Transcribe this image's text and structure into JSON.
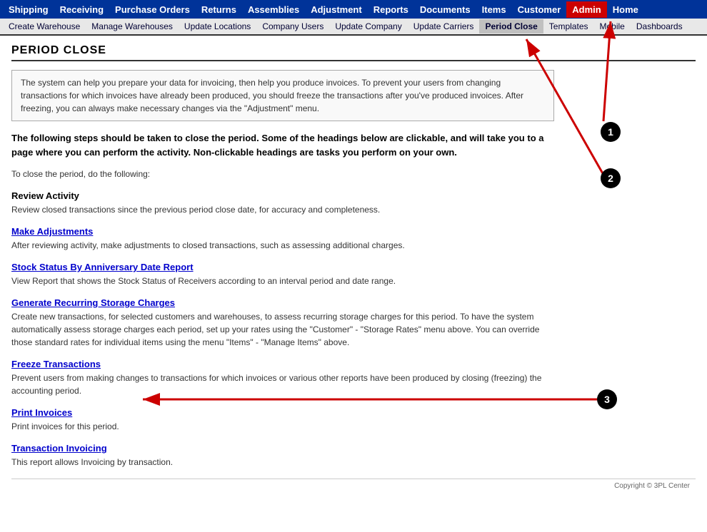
{
  "topNav": {
    "items": [
      {
        "label": "Shipping",
        "active": false
      },
      {
        "label": "Receiving",
        "active": false
      },
      {
        "label": "Purchase Orders",
        "active": false
      },
      {
        "label": "Returns",
        "active": false
      },
      {
        "label": "Assemblies",
        "active": false
      },
      {
        "label": "Adjustment",
        "active": false
      },
      {
        "label": "Reports",
        "active": false
      },
      {
        "label": "Documents",
        "active": false
      },
      {
        "label": "Items",
        "active": false
      },
      {
        "label": "Customer",
        "active": false
      },
      {
        "label": "Admin",
        "active": true
      },
      {
        "label": "Home",
        "active": false
      }
    ]
  },
  "subNav": {
    "items": [
      {
        "label": "Create Warehouse",
        "active": false
      },
      {
        "label": "Manage Warehouses",
        "active": false
      },
      {
        "label": "Update Locations",
        "active": false
      },
      {
        "label": "Company Users",
        "active": false
      },
      {
        "label": "Update Company",
        "active": false
      },
      {
        "label": "Update Carriers",
        "active": false
      },
      {
        "label": "Period Close",
        "active": true
      },
      {
        "label": "Templates",
        "active": false
      },
      {
        "label": "Mobile",
        "active": false
      },
      {
        "label": "Dashboards",
        "active": false
      }
    ]
  },
  "page": {
    "title": "Period Close",
    "infoBox": "The system can help you prepare your data for invoicing, then help you produce invoices. To prevent your users from changing transactions for which invoices have already been produced, you should freeze the transactions after you've produced invoices. After freezing, you can always make necessary changes via the \"Adjustment\" menu.",
    "boldIntro": "The following steps should be taken to close the period. Some of the headings below are clickable, and will take you to a page where you can perform the activity. Non-clickable headings are tasks you perform on your own.",
    "introText": "To close the period, do the following:",
    "sections": [
      {
        "title": "Review Activity",
        "isLink": false,
        "desc": "Review closed transactions since the previous period close date, for accuracy and completeness."
      },
      {
        "title": "Make Adjustments",
        "isLink": true,
        "desc": "After reviewing activity, make adjustments to closed transactions, such as assessing additional charges."
      },
      {
        "title": "Stock Status By Anniversary Date Report",
        "isLink": true,
        "desc": "View Report that shows the Stock Status of Receivers according to an interval period and date range."
      },
      {
        "title": "Generate Recurring Storage Charges",
        "isLink": true,
        "desc": "Create new transactions, for selected customers and warehouses, to assess recurring storage charges for this period. To have the system automatically assess storage charges each period, set up your rates using the \"Customer\" - \"Storage Rates\" menu above. You can override those standard rates for individual items using the menu \"Items\" - \"Manage Items\" above."
      },
      {
        "title": "Freeze Transactions",
        "isLink": true,
        "desc": "Prevent users from making changes to transactions for which invoices or various other reports have been produced by closing (freezing) the accounting period."
      },
      {
        "title": "Print Invoices",
        "isLink": true,
        "desc": "Print invoices for this period."
      },
      {
        "title": "Transaction Invoicing",
        "isLink": true,
        "desc": "This report allows Invoicing by transaction."
      }
    ]
  },
  "copyright": "Copyright © 3PL Center"
}
